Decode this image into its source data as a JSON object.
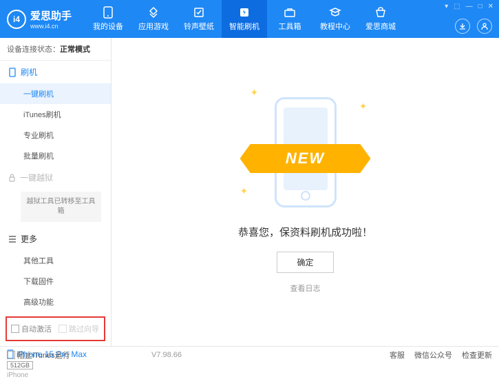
{
  "app": {
    "title": "爱思助手",
    "subtitle": "www.i4.cn"
  },
  "nav": [
    {
      "label": "我的设备"
    },
    {
      "label": "应用游戏"
    },
    {
      "label": "铃声壁纸"
    },
    {
      "label": "智能刷机"
    },
    {
      "label": "工具箱"
    },
    {
      "label": "教程中心"
    },
    {
      "label": "爱思商城"
    }
  ],
  "status": {
    "label": "设备连接状态：",
    "value": "正常模式"
  },
  "sidebar": {
    "flash": {
      "title": "刷机",
      "items": [
        "一键刷机",
        "iTunes刷机",
        "专业刷机",
        "批量刷机"
      ]
    },
    "jailbreak": {
      "title": "一键越狱",
      "note": "越狱工具已转移至工具箱"
    },
    "more": {
      "title": "更多",
      "items": [
        "其他工具",
        "下载固件",
        "高级功能"
      ]
    }
  },
  "checkboxes": {
    "auto_activate": "自动激活",
    "skip_guide": "跳过向导"
  },
  "device": {
    "name": "iPhone 15 Pro Max",
    "storage": "512GB",
    "type": "iPhone"
  },
  "main": {
    "ribbon": "NEW",
    "success": "恭喜您，保资料刷机成功啦！",
    "ok": "确定",
    "view_log": "查看日志"
  },
  "footer": {
    "block_itunes": "阻止iTunes运行",
    "version": "V7.98.66",
    "links": [
      "客服",
      "微信公众号",
      "检查更新"
    ]
  }
}
